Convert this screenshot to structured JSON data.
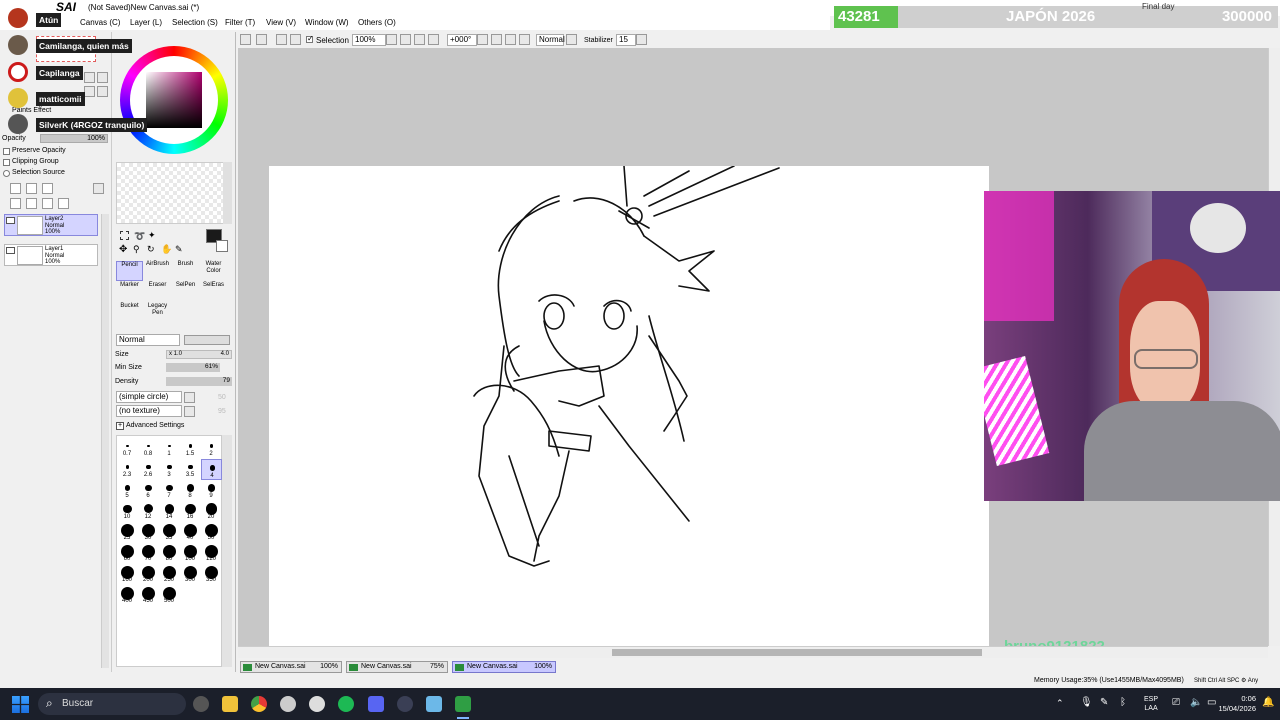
{
  "window": {
    "app_logo": "SAI",
    "title": "(Not Saved)New Canvas.sai (*)",
    "menu": [
      "Canvas (C)",
      "Layer (L)",
      "Selection (S)",
      "Filter (T)",
      "View (V)",
      "Window (W)",
      "Others (O)"
    ]
  },
  "overlay": {
    "counter_left": "43281",
    "goal_title": "JAPÓN 2026",
    "counter_right": "300000",
    "final_day": "Final day",
    "chat": [
      {
        "name": "Atún"
      },
      {
        "name": "Camilanga, quien más"
      },
      {
        "name": "Capilanga"
      },
      {
        "name": "matticomii"
      },
      {
        "name": "SilverK (4RGOZ tranquilo)"
      }
    ],
    "signature": "bruno9121822"
  },
  "toolbar": {
    "selection_label": "Selection",
    "zoom": "100%",
    "rotation": "+000°",
    "blend_mode": "Normal",
    "stabilizer_label": "Stabilizer",
    "stabilizer_value": "15"
  },
  "layer_panel": {
    "effect_label": "Paints Effect",
    "opacity_label": "Opacity",
    "opacity_value": "100%",
    "options": [
      "Preserve Opacity",
      "Clipping Group",
      "Selection Source"
    ],
    "layers": [
      {
        "name": "Layer2",
        "mode": "Normal",
        "opacity": "100%",
        "selected": true
      },
      {
        "name": "Layer1",
        "mode": "Normal",
        "opacity": "100%",
        "selected": false
      }
    ]
  },
  "tools": {
    "brushes": [
      {
        "name": "Pencil",
        "selected": true
      },
      {
        "name": "AirBrush"
      },
      {
        "name": "Brush"
      },
      {
        "name": "Water Color"
      },
      {
        "name": "Marker"
      },
      {
        "name": "Eraser"
      },
      {
        "name": "SelPen"
      },
      {
        "name": "SelEras"
      },
      {
        "name": "Bucket"
      },
      {
        "name": "Legacy Pen"
      }
    ],
    "blend": "Normal",
    "size_label": "Size",
    "size_mult": "x 1.0",
    "size_value": "4.0",
    "min_size_label": "Min Size",
    "min_size_value": "61%",
    "density_label": "Density",
    "density_value": "79",
    "shape": "(simple circle)",
    "texture": "(no texture)",
    "shape_value": "50",
    "texture_value": "95",
    "advanced": "Advanced Settings",
    "brush_sizes": [
      "0.7",
      "0.8",
      "1",
      "1.5",
      "2",
      "2.3",
      "2.6",
      "3",
      "3.5",
      "4",
      "5",
      "6",
      "7",
      "8",
      "9",
      "10",
      "12",
      "14",
      "16",
      "20",
      "25",
      "30",
      "35",
      "40",
      "50",
      "60",
      "70",
      "80",
      "100",
      "120",
      "160",
      "200",
      "250",
      "300",
      "350",
      "400",
      "450",
      "500"
    ],
    "selected_brush_size": "4",
    "primary_color": "#1a1a1a",
    "secondary_color": "#ffffff"
  },
  "documents": [
    {
      "name": "New Canvas.sai",
      "zoom": "100%"
    },
    {
      "name": "New Canvas.sai",
      "zoom": "75%"
    },
    {
      "name": "New Canvas.sai",
      "zoom": "100%",
      "active": true
    }
  ],
  "status": {
    "memory": "Memory Usage:35% (Use1455MB/Max4095MB)",
    "keys": "Shift Ctrl Alt SPC ⚙ Any"
  },
  "taskbar": {
    "search_placeholder": "Buscar",
    "lang_top": "ESP",
    "lang_bottom": "LAA",
    "time": "0:06",
    "date": "15/04/2026"
  },
  "colors": {
    "counter_left_bg": "#5fc24f",
    "selected_layer": "#d4d4ff",
    "taskbar": "#1b1f2a"
  }
}
